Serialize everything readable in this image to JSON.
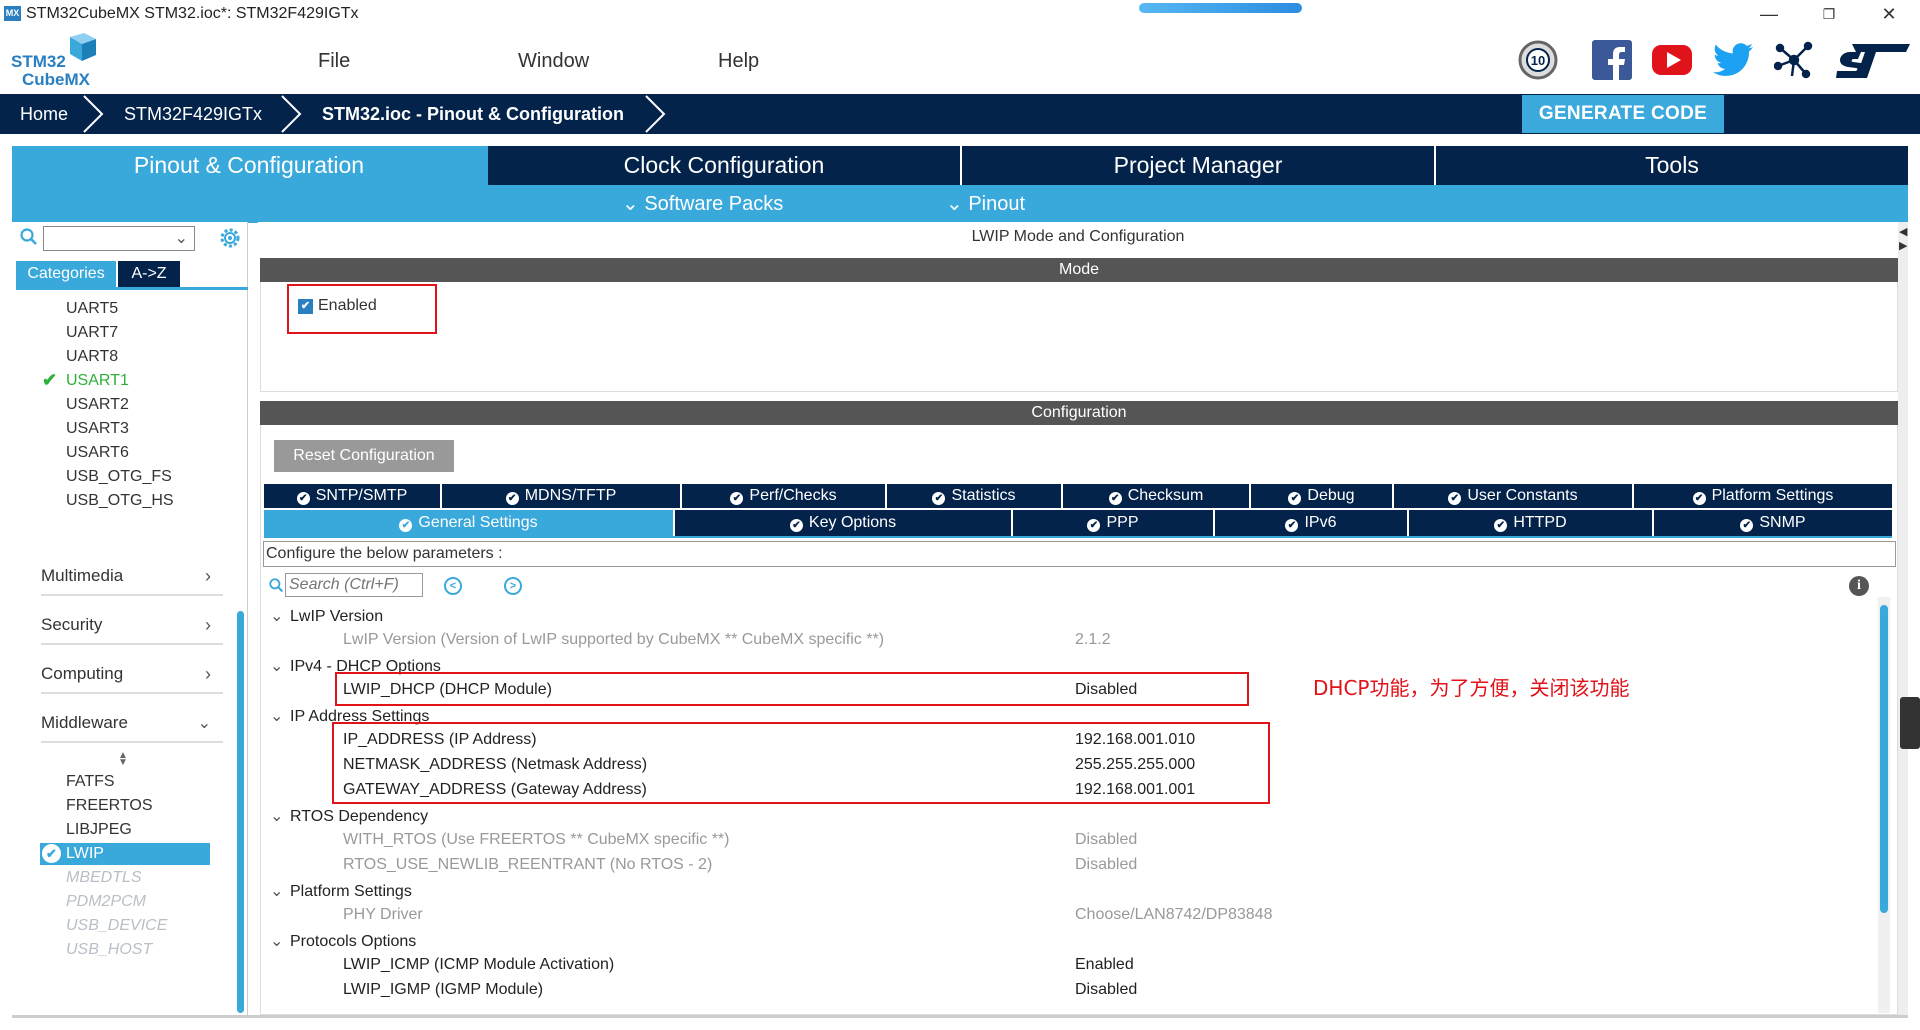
{
  "window": {
    "app_icon": "MX",
    "title": "STM32CubeMX STM32.ioc*: STM32F429IGTx",
    "controls": [
      "—",
      "❐",
      "✕"
    ]
  },
  "logo": {
    "line1": "STM32",
    "line2": "CubeMX"
  },
  "menu": [
    "File",
    "Window",
    "Help"
  ],
  "social_icons": [
    "anniversary-10-badge-icon",
    "facebook-icon",
    "youtube-icon",
    "twitter-icon",
    "network-icon",
    "st-logo-icon"
  ],
  "badge_text": "10",
  "breadcrumb": [
    "Home",
    "STM32F429IGTx",
    "STM32.ioc - Pinout & Configuration"
  ],
  "generate_button": "GENERATE CODE",
  "main_tabs": [
    "Pinout & Configuration",
    "Clock Configuration",
    "Project Manager",
    "Tools"
  ],
  "sub_tabs": [
    "Software Packs",
    "Pinout"
  ],
  "left": {
    "tabs": [
      "Categories",
      "A->Z"
    ],
    "connectivity_items": [
      "UART5",
      "UART7",
      "UART8",
      "USART1",
      "USART2",
      "USART3",
      "USART6",
      "USB_OTG_FS",
      "USB_OTG_HS"
    ],
    "sections": [
      "Multimedia",
      "Security",
      "Computing",
      "Middleware"
    ],
    "middleware_items": [
      "FATFS",
      "FREERTOS",
      "LIBJPEG",
      "LWIP",
      "MBEDTLS",
      "PDM2PCM",
      "USB_DEVICE",
      "USB_HOST"
    ]
  },
  "mode_panel": {
    "title": "LWIP Mode and Configuration",
    "mode_header": "Mode",
    "enabled_label": "Enabled",
    "enabled_checked": true
  },
  "config": {
    "header": "Configuration",
    "reset_button": "Reset Configuration",
    "tabs_row1": [
      "SNTP/SMTP",
      "MDNS/TFTP",
      "Perf/Checks",
      "Statistics",
      "Checksum",
      "Debug",
      "User Constants",
      "Platform Settings"
    ],
    "tabs_row2": [
      "General Settings",
      "Key Options",
      "PPP",
      "IPv6",
      "HTTPD",
      "SNMP"
    ],
    "instruction": "Configure the below parameters :",
    "search_placeholder": "Search (Ctrl+F)",
    "groups": [
      {
        "name": "LwIP Version",
        "params": [
          {
            "name": "LwIP Version (Version of LwIP supported by CubeMX ** CubeMX specific **)",
            "value": "2.1.2",
            "readonly": true
          }
        ]
      },
      {
        "name": "IPv4 - DHCP Options",
        "params": [
          {
            "name": "LWIP_DHCP (DHCP Module)",
            "value": "Disabled",
            "readonly": false
          }
        ]
      },
      {
        "name": "IP Address Settings",
        "params": [
          {
            "name": "IP_ADDRESS (IP Address)",
            "value": "192.168.001.010",
            "readonly": false
          },
          {
            "name": "NETMASK_ADDRESS (Netmask Address)",
            "value": "255.255.255.000",
            "readonly": false
          },
          {
            "name": "GATEWAY_ADDRESS (Gateway Address)",
            "value": "192.168.001.001",
            "readonly": false
          }
        ]
      },
      {
        "name": "RTOS Dependency",
        "params": [
          {
            "name": "WITH_RTOS (Use FREERTOS ** CubeMX specific **)",
            "value": "Disabled",
            "readonly": true
          },
          {
            "name": "RTOS_USE_NEWLIB_REENTRANT (No RTOS - 2)",
            "value": "Disabled",
            "readonly": true
          }
        ]
      },
      {
        "name": "Platform Settings",
        "params": [
          {
            "name": "PHY Driver",
            "value": "Choose/LAN8742/DP83848",
            "readonly": true
          }
        ]
      },
      {
        "name": "Protocols Options",
        "params": [
          {
            "name": "LWIP_ICMP (ICMP Module Activation)",
            "value": "Enabled",
            "readonly": false
          },
          {
            "name": "LWIP_IGMP (IGMP Module)",
            "value": "Disabled",
            "readonly": false
          }
        ]
      }
    ]
  },
  "annotation": "DHCP功能，为了方便，关闭该功能",
  "colors": {
    "accent": "#39a9dc",
    "dark": "#03234b",
    "annotation": "#e0121a"
  }
}
